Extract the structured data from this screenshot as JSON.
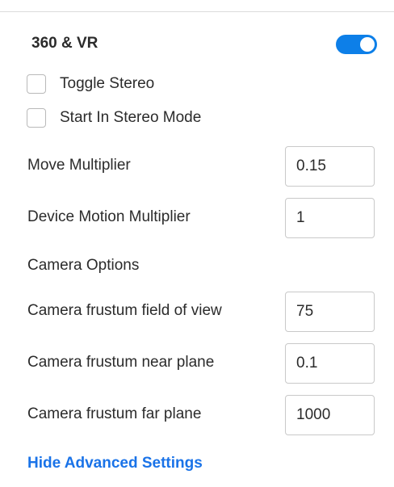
{
  "section": {
    "title": "360 & VR",
    "enabled": true
  },
  "checkboxes": [
    {
      "label": "Toggle Stereo",
      "checked": false
    },
    {
      "label": "Start In Stereo Mode",
      "checked": false
    }
  ],
  "fields": [
    {
      "label": "Move Multiplier",
      "value": "0.15"
    },
    {
      "label": "Device Motion Multiplier",
      "value": "1"
    },
    {
      "label": "Camera frustum field of view",
      "value": "75"
    },
    {
      "label": "Camera frustum near plane",
      "value": "0.1"
    },
    {
      "label": "Camera frustum far plane",
      "value": "1000"
    }
  ],
  "camera_options_heading": "Camera Options",
  "advanced_link": "Hide Advanced Settings",
  "colors": {
    "accent": "#0d7fe8",
    "link": "#1a73e8"
  }
}
